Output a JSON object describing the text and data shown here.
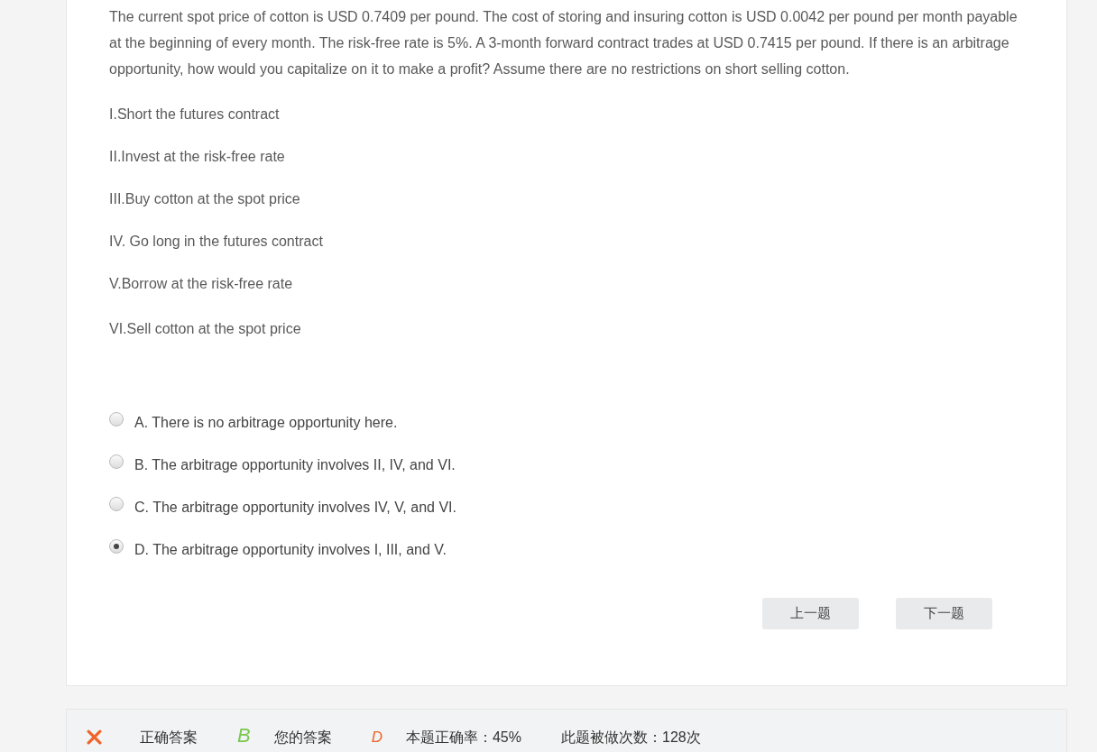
{
  "question": "The current spot price of cotton is USD 0.7409 per pound. The cost of storing and insuring cotton is USD 0.0042 per pound per month payable at the beginning of every month. The risk-free rate is 5%. A 3-month forward contract trades at USD 0.7415 per pound. If there is an arbitrage opportunity, how would you capitalize on it to make a profit? Assume there are no restrictions on short selling cotton.",
  "statements": [
    "I.Short the futures contract",
    "II.Invest at the risk-free rate",
    "III.Buy cotton at the spot price",
    "IV. Go long in the futures contract",
    "V.Borrow at the risk-free rate",
    "VI.Sell cotton at the spot price"
  ],
  "options": [
    {
      "label": "A. There is no arbitrage opportunity here.",
      "selected": false
    },
    {
      "label": "B. The arbitrage opportunity involves II, IV, and VI.",
      "selected": false
    },
    {
      "label": "C. The arbitrage opportunity involves IV, V, and VI.",
      "selected": false
    },
    {
      "label": "D. The arbitrage opportunity involves I, III, and V.",
      "selected": true
    }
  ],
  "buttons": [
    "上一题",
    "下一题"
  ],
  "result": {
    "correct": false,
    "correct_label": "正确答案",
    "correct_answer": "B",
    "your_label": "您的答案",
    "your_answer": "D",
    "accuracy": "本题正确率：45%",
    "attempts": "此题被做次数：128次"
  }
}
